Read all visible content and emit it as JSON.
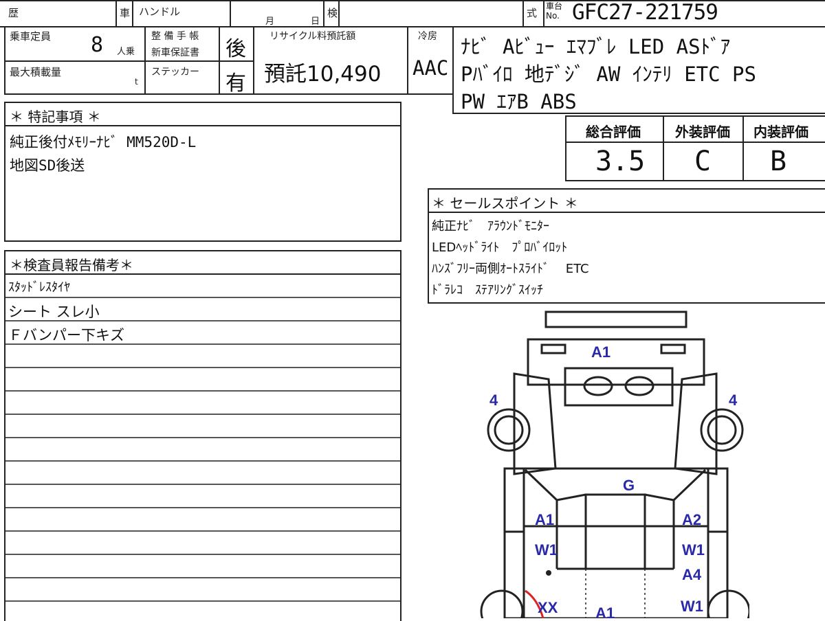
{
  "header": {
    "reki_label": "歴",
    "sha_label": "車",
    "handle_label": "ハンドル",
    "tsuki_label": "月",
    "hi_label": "日",
    "ken_label": "検",
    "shiki_label": "式",
    "chassis_label_top": "車台",
    "chassis_label_bottom": "No.",
    "chassis_number": "GFC27-221759"
  },
  "specs": {
    "capacity_label": "乗車定員",
    "capacity_value": "8",
    "capacity_unit": "人乗",
    "max_load_label": "最大積載量",
    "max_load_unit": "t",
    "maintenance_label": "整 備 手 帳",
    "warranty_label": "新車保証書",
    "warranty_value": "後",
    "sticker_label": "ステッカー",
    "sticker_value": "有",
    "recycle_label": "リサイクル料預託額",
    "recycle_value": "預託10,490",
    "ac_label": "冷房",
    "ac_value": "AAC"
  },
  "equipment_lines": [
    "ﾅﾋﾞ Aﾋﾞｭｰ ｴﾏﾌﾞﾚ LED ASﾄﾞｱ",
    "Pﾊﾞｲﾛ 地ﾃﾞｼﾞ AW ｲﾝﾃﾘ ETC PS",
    "PW ｴｱB ABS"
  ],
  "scores": {
    "overall_label": "総合評価",
    "overall_value": "3.5",
    "exterior_label": "外装評価",
    "exterior_value": "C",
    "interior_label": "内装評価",
    "interior_value": "B"
  },
  "special_notes": {
    "title": "＊ 特記事項 ＊",
    "lines": [
      "純正後付ﾒﾓﾘｰﾅﾋﾞ MM520D-L",
      "地図SD後送"
    ]
  },
  "sales_points": {
    "title": "＊ セールスポイント ＊",
    "lines": [
      "純正ﾅﾋﾞ　ｱﾗｳﾝﾄﾞﾓﾆﾀｰ",
      "LEDﾍｯﾄﾞﾗｲﾄ　ﾌﾟﾛﾊﾞｲﾛｯﾄ",
      "ﾊﾝｽﾞﾌﾘｰ両側ｵｰﾄｽﾗｲﾄﾞ　 ETC",
      "ﾄﾞﾗﾚｺ　ｽﾃｱﾘﾝｸﾞｽｲｯﾁ"
    ]
  },
  "inspector_notes": {
    "title": "＊検査員報告備考＊",
    "lines": [
      "ｽﾀｯﾄﾞﾚｽﾀｲﾔ",
      "シート スレ小",
      "Ｆバンパー下キズ"
    ]
  },
  "damage_map": {
    "labels": [
      "A1",
      "4",
      "4",
      "G",
      "A1",
      "A2",
      "W1",
      "W1",
      "A4",
      "XX",
      "A1",
      "W1"
    ],
    "label_color": "#2a2aa8",
    "highlight_color": "#d22"
  }
}
